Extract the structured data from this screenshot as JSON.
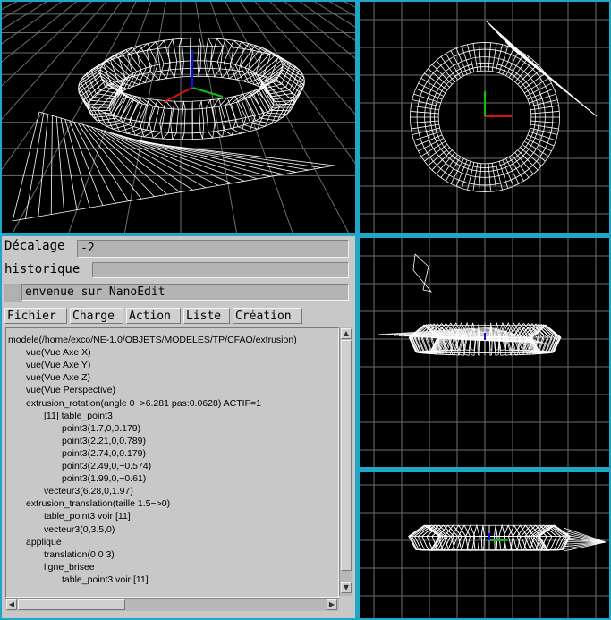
{
  "offset": {
    "label": "Décalage",
    "value": "-2"
  },
  "history": {
    "label": "historique",
    "value": ""
  },
  "status_message": "envenue sur NanoÉdit",
  "menu": [
    "Fichier",
    "Charge",
    "Action",
    "Liste",
    "Création"
  ],
  "tree": [
    {
      "depth": 0,
      "text": "modele(/home/exco/NE-1.0/OBJETS/MODELES/TP/CFAO/extrusion)"
    },
    {
      "depth": 1,
      "text": "vue(Vue Axe X)"
    },
    {
      "depth": 1,
      "text": "vue(Vue Axe Y)"
    },
    {
      "depth": 1,
      "text": "vue(Vue Axe Z)"
    },
    {
      "depth": 1,
      "text": "vue(Vue Perspective)"
    },
    {
      "depth": 1,
      "text": "extrusion_rotation(angle 0−>6.281 pas:0.0628)  ACTIF=1"
    },
    {
      "depth": 2,
      "text": "[11] table_point3"
    },
    {
      "depth": 3,
      "text": "point3(1.7,0,0.179)"
    },
    {
      "depth": 3,
      "text": "point3(2.21,0,0.789)"
    },
    {
      "depth": 3,
      "text": "point3(2.74,0,0.179)"
    },
    {
      "depth": 3,
      "text": "point3(2.49,0,−0.574)"
    },
    {
      "depth": 3,
      "text": "point3(1.99,0,−0.61)"
    },
    {
      "depth": 2,
      "text": "vecteur3(6.28,0,1.97)"
    },
    {
      "depth": 1,
      "text": "extrusion_translation(taille 1.5−>0)"
    },
    {
      "depth": 2,
      "text": "table_point3 voir [11]"
    },
    {
      "depth": 2,
      "text": "vecteur3(0,3.5,0)"
    },
    {
      "depth": 1,
      "text": "applique"
    },
    {
      "depth": 2,
      "text": "translation(0 0 3)"
    },
    {
      "depth": 2,
      "text": "ligne_brisee"
    },
    {
      "depth": 3,
      "text": "table_point3 voir [11]"
    }
  ],
  "colors": {
    "frame": "#1fa6c8",
    "viewport_bg": "#000000",
    "wire": "#ffffff",
    "grid": "#6e6e6e",
    "axis_x": "#e01010",
    "axis_y": "#10c010",
    "axis_z": "#1010e0",
    "panel": "#c8c8c8"
  }
}
